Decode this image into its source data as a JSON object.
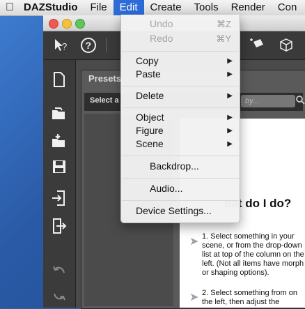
{
  "menubar": {
    "apple_icon": "apple-logo-icon",
    "app_name": "DAZStudio",
    "items": [
      "File",
      "Edit",
      "Create",
      "Tools",
      "Render",
      "Con"
    ]
  },
  "toolbar": {
    "icons": [
      "pointer-help-icon",
      "help-icon"
    ]
  },
  "panel": {
    "title": "Presets",
    "select_label": "Select a",
    "search_placeholder": "by..."
  },
  "tips": {
    "heading": "hat do I do?",
    "step1": "1. Select something in your scene, or from the drop-down list at top of the column on the left. (Not all items have morph or shaping options).",
    "step2": "2. Select something from on the left, then adjust the"
  },
  "edit_menu": {
    "undo": {
      "label": "Undo",
      "shortcut": "⌘Z"
    },
    "redo": {
      "label": "Redo",
      "shortcut": "⌘Y"
    },
    "copy": "Copy",
    "paste": "Paste",
    "delete": "Delete",
    "object": "Object",
    "figure": "Figure",
    "scene": "Scene",
    "backdrop": "Backdrop...",
    "audio": "Audio...",
    "device_settings": "Device Settings..."
  },
  "colors": {
    "menu_highlight": "#2d6cd6",
    "desktop": "#2a5aa6"
  }
}
